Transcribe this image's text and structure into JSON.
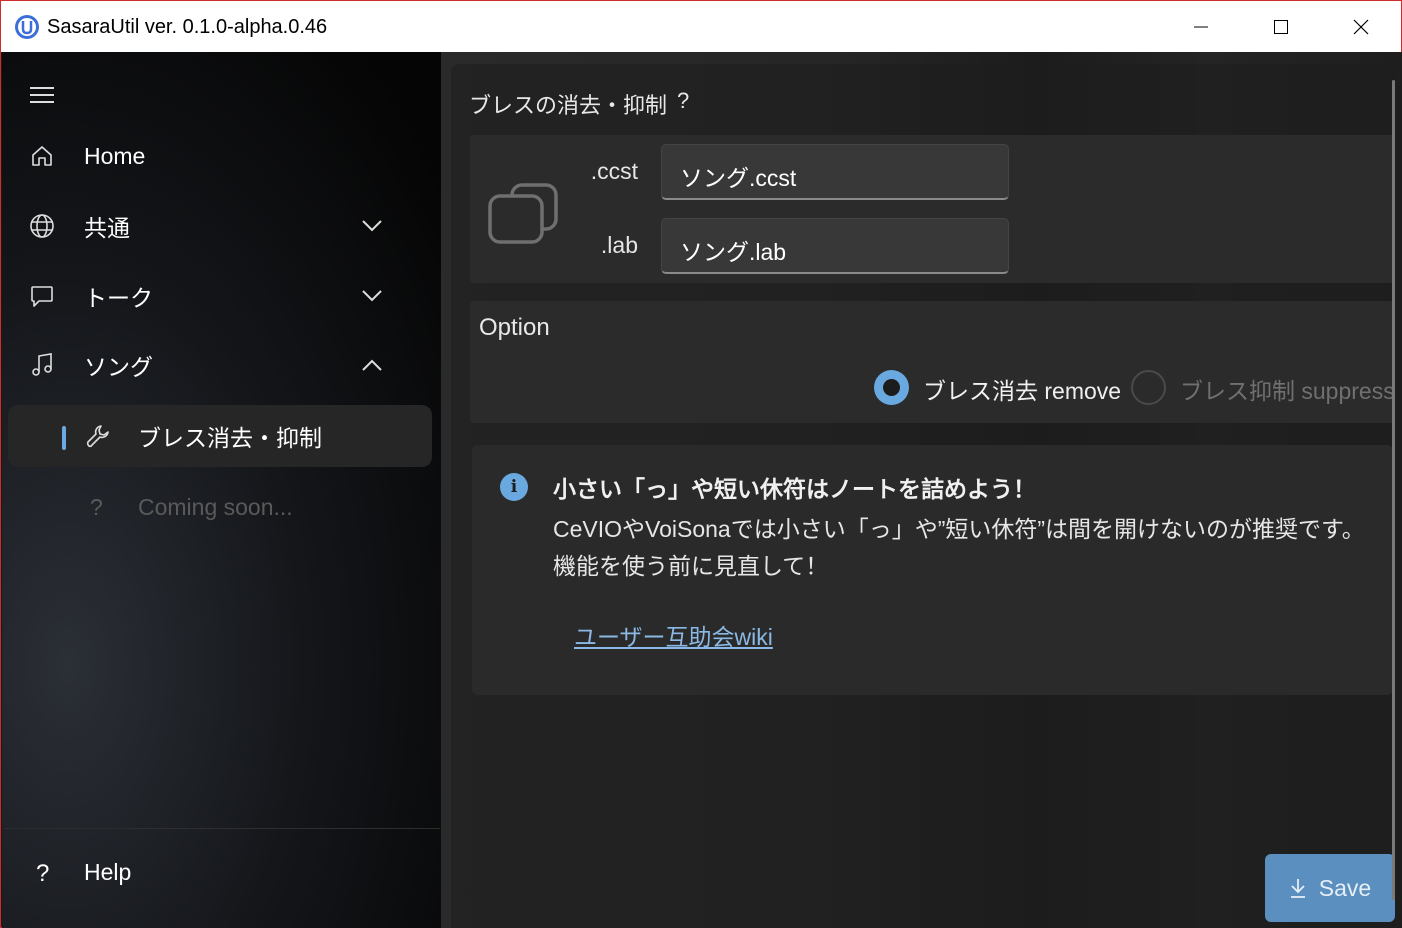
{
  "window": {
    "title": "SasaraUtil ver. 0.1.0-alpha.0.46",
    "icon": "app-logo-icon"
  },
  "sidebar": {
    "items": [
      {
        "label": "Home",
        "icon": "home-icon"
      },
      {
        "label": "共通",
        "icon": "globe-icon",
        "expanded": false
      },
      {
        "label": "トーク",
        "icon": "chat-icon",
        "expanded": false
      },
      {
        "label": "ソング",
        "icon": "music-note-icon",
        "expanded": true
      }
    ],
    "sub_items": [
      {
        "label": "ブレス消去・抑制",
        "icon": "wrench-icon",
        "selected": true
      },
      {
        "label": "Coming soon...",
        "icon": "?",
        "disabled": true
      }
    ],
    "help": {
      "label": "Help",
      "icon": "?"
    }
  },
  "page": {
    "title": "ブレスの消去・抑制",
    "help_icon": "?"
  },
  "files": {
    "ccst_label": ".ccst",
    "ccst_value": "ソング.ccst",
    "lab_label": ".lab",
    "lab_value": "ソング.lab"
  },
  "option": {
    "title": "Option",
    "remove_label": "ブレス消去 remove",
    "remove_selected": true,
    "suppress_label": "ブレス抑制 suppress",
    "suppress_enabled": false
  },
  "info": {
    "title": "小さい「っ」や短い休符はノートを詰めよう！",
    "body": "CeVIOやVoiSonaでは小さい「っ」や”短い休符”は間を開けないのが推奨です。機能を使う前に見直して！",
    "link": "ユーザー互助会wiki"
  },
  "save": {
    "label": "Save"
  },
  "colors": {
    "accent": "#6aa8e0",
    "save_button": "#5a8fbf",
    "link": "#8ab9e6"
  }
}
